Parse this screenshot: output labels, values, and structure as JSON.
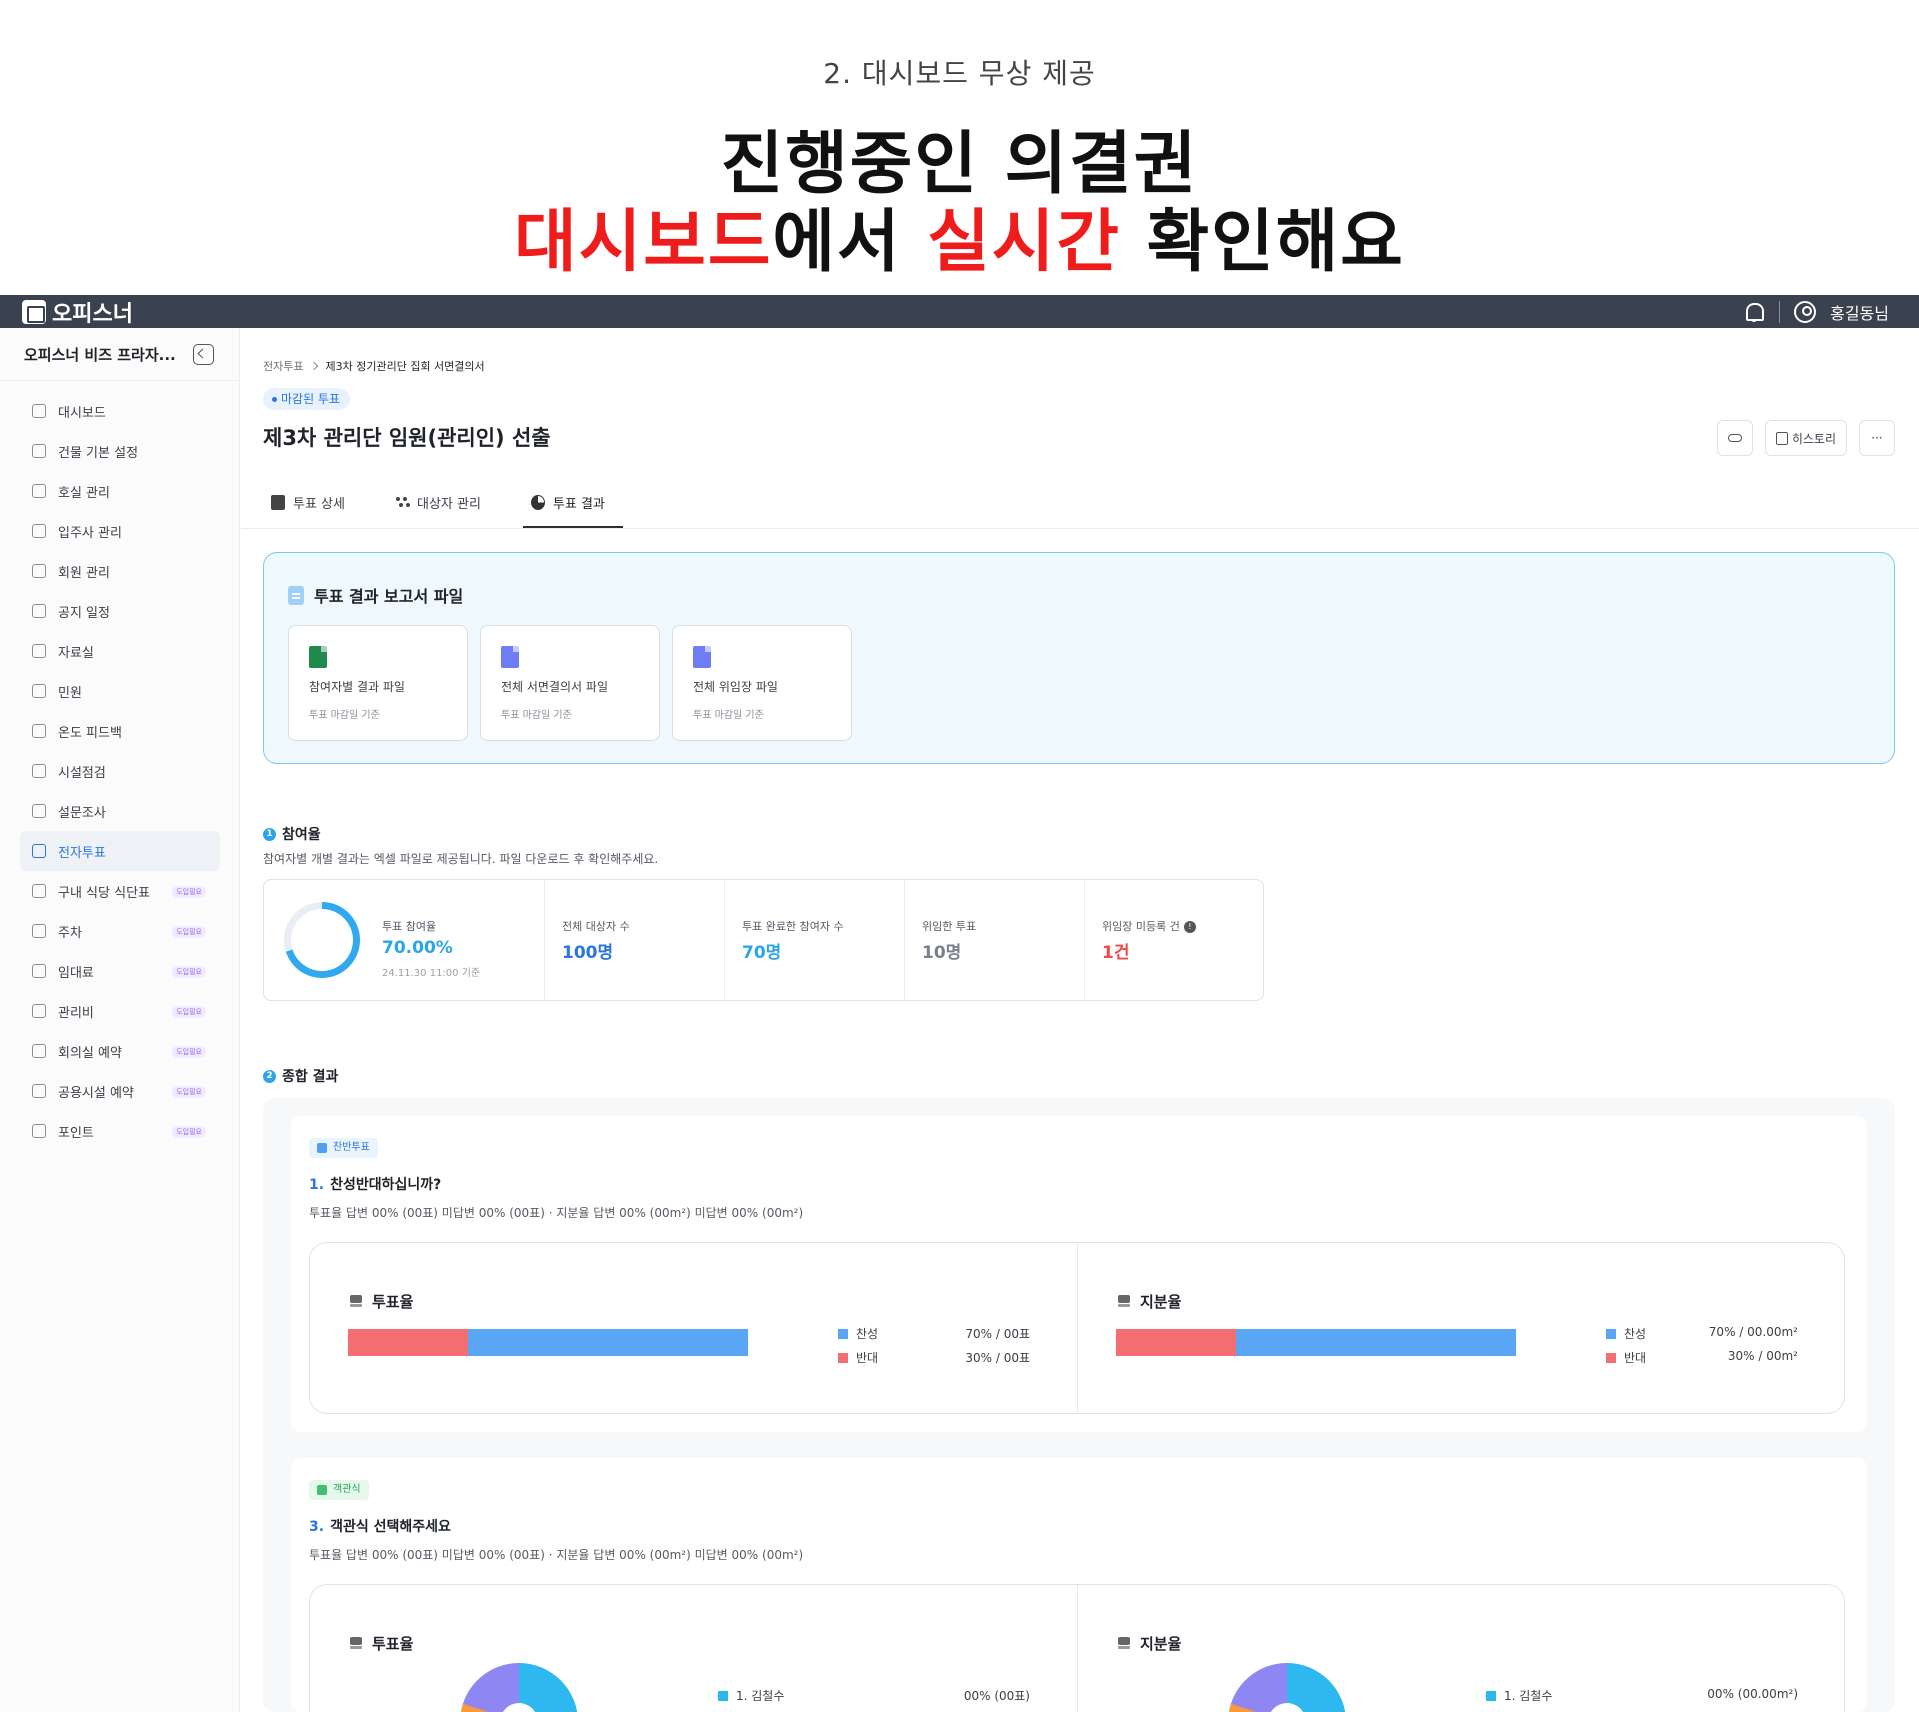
{
  "promo": {
    "subtitle": "2. 대시보드 무상 제공",
    "headline1": "진행중인 의결권",
    "headline2_red1": "대시보드",
    "headline2_mid": "에서 ",
    "headline2_red2": "실시간",
    "headline2_end": " 확인해요"
  },
  "topbar": {
    "brand": "오피스너",
    "user": "홍길동님"
  },
  "sidebar": {
    "org_name": "오피스너 비즈 프라자...",
    "items": [
      {
        "label": "대시보드",
        "badge": ""
      },
      {
        "label": "건물 기본 설정",
        "badge": ""
      },
      {
        "label": "호실 관리",
        "badge": ""
      },
      {
        "label": "입주사 관리",
        "badge": ""
      },
      {
        "label": "회원 관리",
        "badge": ""
      },
      {
        "label": "공지 일정",
        "badge": ""
      },
      {
        "label": "자료실",
        "badge": ""
      },
      {
        "label": "민원",
        "badge": ""
      },
      {
        "label": "온도 피드백",
        "badge": ""
      },
      {
        "label": "시설점검",
        "badge": ""
      },
      {
        "label": "설문조사",
        "badge": ""
      },
      {
        "label": "전자투표",
        "badge": "",
        "active": true
      },
      {
        "label": "구내 식당 식단표",
        "badge": "도입필요"
      },
      {
        "label": "주차",
        "badge": "도입필요"
      },
      {
        "label": "임대료",
        "badge": "도입필요"
      },
      {
        "label": "관리비",
        "badge": "도입필요"
      },
      {
        "label": "회의실 예약",
        "badge": "도입필요"
      },
      {
        "label": "공용시설 예약",
        "badge": "도입필요"
      },
      {
        "label": "포인트",
        "badge": "도입필요"
      }
    ]
  },
  "breadcrumb": {
    "root": "전자투표",
    "current": "제3차 정기관리단 집회 서면결의서"
  },
  "status": "마감된 투표",
  "title": "제3차 관리단 임원(관리인) 선출",
  "actions": {
    "history": "히스토리",
    "more": "···"
  },
  "tabs": [
    {
      "label": "투표 상세"
    },
    {
      "label": "대상자 관리"
    },
    {
      "label": "투표 결과"
    }
  ],
  "report": {
    "title": "투표 결과 보고서 파일",
    "files": [
      {
        "name": "참여자별 결과 파일",
        "sub": "투표 마감일 기준",
        "type": "xls"
      },
      {
        "name": "전체 서면결의서 파일",
        "sub": "투표 마감일 기준",
        "type": "zip"
      },
      {
        "name": "전체 위임장 파일",
        "sub": "투표 마감일 기준",
        "type": "zip"
      }
    ]
  },
  "participation": {
    "num": "1",
    "title": "참여율",
    "desc": "참여자별 개별 결과는 엑셀 파일로 제공됩니다. 파일 다운로드 후 확인해주세요.",
    "rate_label": "투표 참여율",
    "rate_value": "70.00%",
    "rate_fraction": 0.7,
    "rate_note": "24.11.30 11:00 기준",
    "stats": [
      {
        "label": "전체 대상자 수",
        "value": "100명",
        "color": "#2a75e0"
      },
      {
        "label": "투표 완료한 참여자 수",
        "value": "70명",
        "color": "#2aa5e9"
      },
      {
        "label": "위임한 투표",
        "value": "10명",
        "color": "#7a8089"
      },
      {
        "label": "위임장 미등록 건",
        "value": "1건",
        "color": "#ef4b4b"
      }
    ]
  },
  "overall": {
    "num": "2",
    "title": "종합 결과",
    "questions": [
      {
        "chip": "찬반투표",
        "number": "1.",
        "title": "찬성반대하십니까?",
        "meta": "투표율 답변 00% (00표) 미답변 00% (00표)  ·  지분율 답변 00% (00m²)  미답변 00% (00m²)",
        "vote": {
          "title": "투표율",
          "no_fraction": 0.3,
          "legend": [
            {
              "label": "찬성",
              "value": "70% / 00표",
              "color": "#5ba6f4"
            },
            {
              "label": "반대",
              "value": "30% / 00표",
              "color": "#f36d72"
            }
          ]
        },
        "share": {
          "title": "지분율",
          "no_fraction": 0.3,
          "legend": [
            {
              "label": "찬성",
              "value": "70% / 00.00m²",
              "color": "#5ba6f4"
            },
            {
              "label": "반대",
              "value": "30% / 00m²",
              "color": "#f36d72"
            }
          ]
        }
      },
      {
        "chip": "객관식",
        "number": "3.",
        "title": "객관식 선택해주세요",
        "meta": "투표율 답변 00% (00표) 미답변 00% (00표)  ·  지분율 답변 00% (00m²)  미답변 00% (00m²)",
        "vote": {
          "title": "투표율",
          "legend": [
            {
              "label": "1. 김철수",
              "value": "00% (00표)",
              "color": "#2fb7ef"
            }
          ]
        },
        "share": {
          "title": "지분율",
          "legend": [
            {
              "label": "1. 김철수",
              "value": "00% (00.00m²)",
              "color": "#2fb7ef"
            }
          ]
        }
      }
    ]
  }
}
